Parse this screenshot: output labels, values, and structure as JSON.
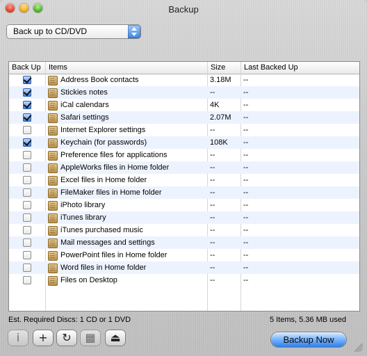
{
  "window": {
    "title": "Backup"
  },
  "popup": {
    "selected": "Back up to CD/DVD"
  },
  "table": {
    "headers": [
      "Back Up",
      "Items",
      "Size",
      "Last Backed Up"
    ],
    "rows": [
      {
        "checked": true,
        "item": "Address Book contacts",
        "size": "3.18M",
        "last": "--"
      },
      {
        "checked": true,
        "item": "Stickies notes",
        "size": "--",
        "last": "--"
      },
      {
        "checked": true,
        "item": "iCal calendars",
        "size": "4K",
        "last": "--"
      },
      {
        "checked": true,
        "item": "Safari settings",
        "size": "2.07M",
        "last": "--"
      },
      {
        "checked": false,
        "item": "Internet Explorer settings",
        "size": "--",
        "last": "--"
      },
      {
        "checked": true,
        "item": "Keychain (for passwords)",
        "size": "108K",
        "last": "--"
      },
      {
        "checked": false,
        "item": "Preference files for applications",
        "size": "--",
        "last": "--"
      },
      {
        "checked": false,
        "item": "AppleWorks files in Home folder",
        "size": "--",
        "last": "--"
      },
      {
        "checked": false,
        "item": "Excel files in Home folder",
        "size": "--",
        "last": "--"
      },
      {
        "checked": false,
        "item": "FileMaker files in Home folder",
        "size": "--",
        "last": "--"
      },
      {
        "checked": false,
        "item": "iPhoto library",
        "size": "--",
        "last": "--"
      },
      {
        "checked": false,
        "item": "iTunes library",
        "size": "--",
        "last": "--"
      },
      {
        "checked": false,
        "item": "iTunes purchased music",
        "size": "--",
        "last": "--"
      },
      {
        "checked": false,
        "item": "Mail messages and settings",
        "size": "--",
        "last": "--"
      },
      {
        "checked": false,
        "item": "PowerPoint files in Home folder",
        "size": "--",
        "last": "--"
      },
      {
        "checked": false,
        "item": "Word files in Home folder",
        "size": "--",
        "last": "--"
      },
      {
        "checked": false,
        "item": "Files on Desktop",
        "size": "--",
        "last": "--"
      }
    ]
  },
  "footer": {
    "est_discs": "Est. Required Discs: 1 CD or 1 DVD",
    "summary": "5 Items, 5.36 MB used"
  },
  "toolbar": {
    "info_glyph": "i",
    "add_glyph": "+",
    "refresh_glyph": "↻",
    "calendar_glyph": "▦",
    "eject_glyph": "⏏",
    "backup_now": "Backup Now"
  }
}
